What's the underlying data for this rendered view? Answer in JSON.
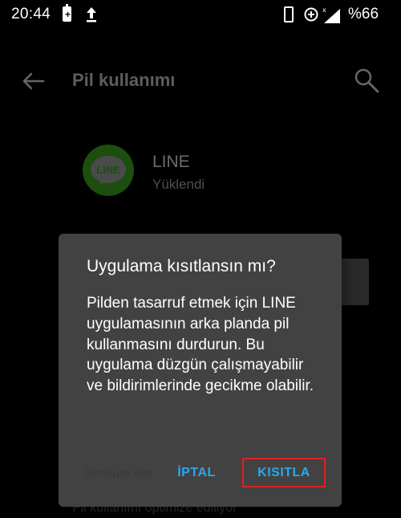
{
  "status_bar": {
    "time": "20:44",
    "battery_percent": "%66",
    "icons": [
      "battery-charging-icon",
      "upload-icon",
      "vibrate-phone-icon",
      "data-saver-icon",
      "signal-icon"
    ]
  },
  "app_bar": {
    "title": "Pil kullanımı",
    "back_icon": "arrow-left-icon",
    "search_icon": "search-icon"
  },
  "app_info": {
    "name": "LINE",
    "status": "Yüklendi",
    "logo_text": "LINE",
    "logo_color": "#1c4e0f"
  },
  "background": {
    "footer_text": "Pil kullanımı optimize ediliyor"
  },
  "dialog": {
    "title": "Uygulama kısıtlansın mı?",
    "message": "Pilden tasarruf etmek için LINE uygulamasının arka planda pil kullanmasını durdurun. Bu uygulama düzgün çalışmayabilir ve bildirimlerinde gecikme olabilir.",
    "watermark": "Sordum.net",
    "cancel_label": "İPTAL",
    "restrict_label": "KISITLA",
    "accent_color": "#2aa8ea",
    "highlight_color": "#e02020"
  }
}
